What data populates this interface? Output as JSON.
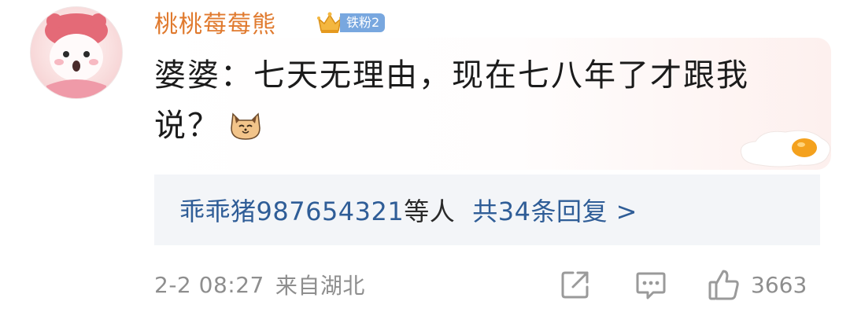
{
  "comment": {
    "username": "桃桃莓莓熊",
    "fan_badge": "铁粉2",
    "text": "婆婆：七天无理由，现在七八年了才跟我说？",
    "emoji_icon": "cat-face-icon",
    "decoration_icon": "fried-egg-icon"
  },
  "replies": {
    "user": "乖乖猪987654321",
    "others": "等人",
    "count_label": "共34条回复 >"
  },
  "meta": {
    "date": "2-2 08:27",
    "location": "来自湖北"
  },
  "actions": {
    "share_icon": "share-icon",
    "comment_icon": "comment-icon",
    "like_icon": "thumbs-up-icon",
    "like_count": "3663"
  },
  "colors": {
    "username": "#e07a2e",
    "link": "#2f5d97",
    "badge": "#78a7df",
    "meta": "#8e8e8e"
  }
}
